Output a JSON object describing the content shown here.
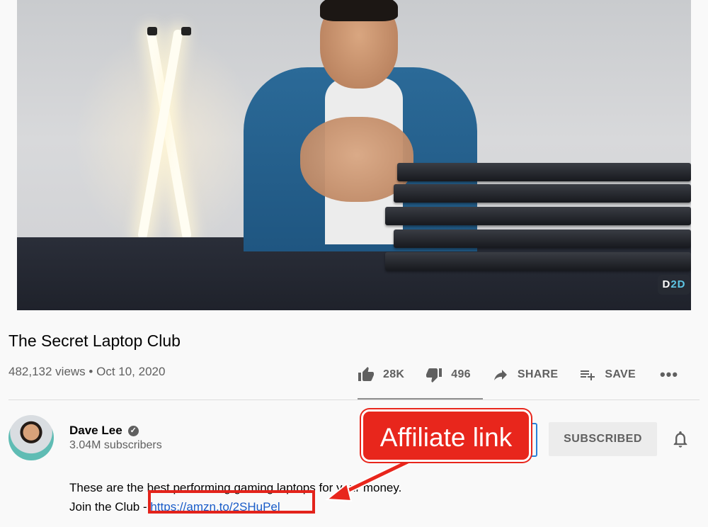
{
  "video": {
    "watermark_left": "D",
    "watermark_right": "2D"
  },
  "title": "The Secret Laptop Club",
  "stats": {
    "views": "482,132 views",
    "separator": " • ",
    "date": "Oct 10, 2020"
  },
  "actions": {
    "likes": "28K",
    "dislikes": "496",
    "share": "SHARE",
    "save": "SAVE",
    "more": "•••"
  },
  "channel": {
    "name": "Dave Lee",
    "verified_mark": "✓",
    "subscribers": "3.04M subscribers",
    "subscribe_label": "SUBSCRIBED"
  },
  "description": {
    "line1": "These are the best performing gaming laptops for your money.",
    "line2_prefix": "Join the Club - ",
    "link": "https://amzn.to/2SHuPel"
  },
  "annotation": {
    "label": "Affiliate link",
    "color": "#e8261c"
  },
  "colors": {
    "link": "#1a5cc8",
    "muted": "#606060",
    "text": "#030303"
  }
}
